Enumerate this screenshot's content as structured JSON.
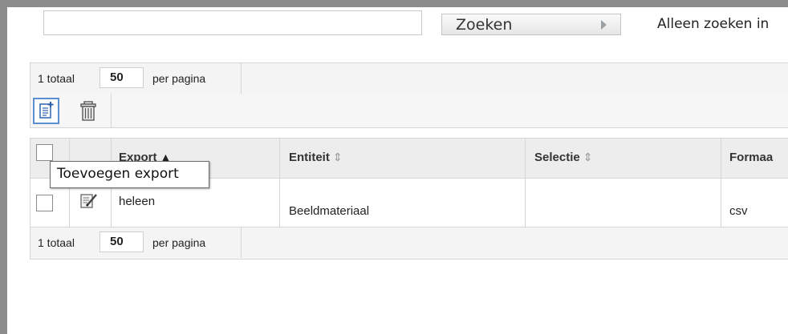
{
  "search": {
    "input_value": "",
    "button_label": "Zoeken",
    "only_search_label": "Alleen zoeken in"
  },
  "paginator_top": {
    "total_label": "1 totaal",
    "page_size": "50",
    "per_page_label": "per pagina"
  },
  "paginator_bottom": {
    "total_label": "1 totaal",
    "page_size": "50",
    "per_page_label": "per pagina"
  },
  "toolbar": {
    "add_icon": "add-document-icon",
    "delete_icon": "trash-icon"
  },
  "table": {
    "columns": [
      {
        "label": "Export",
        "sort": "ascending"
      },
      {
        "label": "Entiteit",
        "sort": "none"
      },
      {
        "label": "Selectie",
        "sort": "none"
      },
      {
        "label": "Formaa",
        "sort": "none"
      }
    ],
    "sort_asc_symbol": "▲",
    "sort_both_symbol": "⇕",
    "rows": [
      {
        "export": "heleen",
        "entiteit": "Beeldmateriaal",
        "selectie": "",
        "formaat": "csv",
        "edit_icon": "edit-icon"
      }
    ]
  },
  "tooltip": {
    "text": "Toevoegen export"
  },
  "colors": {
    "frame": "#8c8c8c",
    "header_bg": "#ededed",
    "accent_border": "#5b8fd1"
  }
}
